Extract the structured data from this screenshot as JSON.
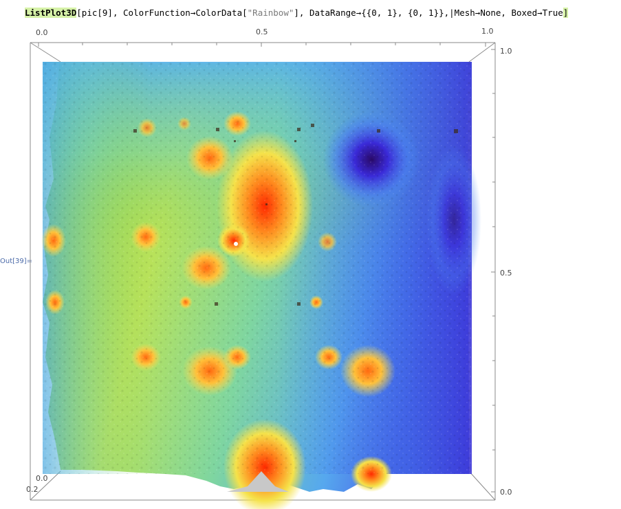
{
  "notebook": {
    "input": {
      "fn": "ListPlot3D",
      "part1": "[pic[9], ColorFunction",
      "arrow": "→",
      "part2": "ColorData[",
      "str": "\"Rainbow\"",
      "part3": "], DataRange",
      "part4": "{{0, 1}, {0, 1}},|Mesh",
      "part5": "None, Boxed",
      "part6": "True",
      "end": "]"
    },
    "out_label": "Out[39]="
  },
  "axes": {
    "top_ticks": [
      "0.0",
      "0.5",
      "1.0"
    ],
    "right_ticks": [
      "1.0",
      "0.5",
      "0.0"
    ],
    "left_ticks": [
      "0.0",
      "0.2"
    ]
  },
  "colors": {
    "box": "#777777",
    "highlight": "#d6f2a8"
  }
}
